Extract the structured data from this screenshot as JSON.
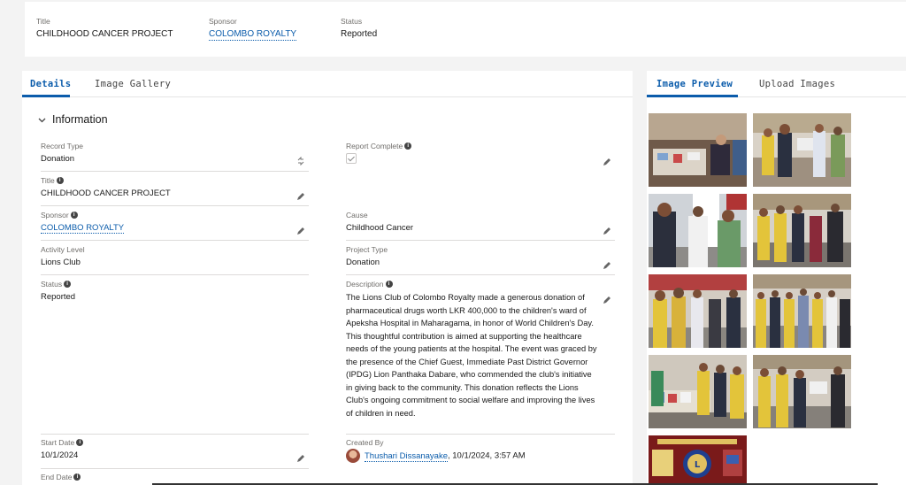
{
  "header": {
    "title_label": "Title",
    "title_value": "CHILDHOOD CANCER PROJECT",
    "sponsor_label": "Sponsor",
    "sponsor_value": "COLOMBO ROYALTY",
    "status_label": "Status",
    "status_value": "Reported"
  },
  "left_tabs": [
    {
      "label": "Details"
    },
    {
      "label": "Image Gallery"
    }
  ],
  "right_tabs": [
    {
      "label": "Image Preview"
    },
    {
      "label": "Upload Images"
    }
  ],
  "section_title": "Information",
  "fields": {
    "record_type": {
      "label": "Record Type",
      "value": "Donation"
    },
    "report_complete": {
      "label": "Report Complete",
      "checked": true
    },
    "title": {
      "label": "Title",
      "value": "CHILDHOOD CANCER PROJECT"
    },
    "sponsor": {
      "label": "Sponsor",
      "value": "COLOMBO ROYALTY"
    },
    "cause": {
      "label": "Cause",
      "value": "Childhood Cancer"
    },
    "activity_level": {
      "label": "Activity Level",
      "value": "Lions Club"
    },
    "project_type": {
      "label": "Project Type",
      "value": "Donation"
    },
    "status": {
      "label": "Status",
      "value": "Reported"
    },
    "description": {
      "label": "Description",
      "value": "The Lions Club of Colombo Royalty made a generous donation of pharmaceutical drugs worth LKR 400,000 to the children's ward of Apeksha Hospital in Maharagama, in honor of World Children's Day. This thoughtful contribution is aimed at supporting the healthcare needs of the young patients at the hospital. The event was graced by the presence of the Chief Guest, Immediate Past District Governor (IPDG) Lion Panthaka Dabare, who commended the club's initiative in giving back to the community. This donation reflects the Lions Club's ongoing commitment to social welfare and improving the lives of children in need."
    },
    "start_date": {
      "label": "Start Date",
      "value": "10/1/2024"
    },
    "created_by": {
      "label": "Created By",
      "user": "Thushari Dissanayake",
      "timestamp": ", 10/1/2024, 3:57 AM"
    },
    "end_date": {
      "label": "End Date"
    }
  },
  "icons": {
    "info": "i",
    "chevron": "chevron-down-icon",
    "edit": "pencil-icon",
    "swap": "change-record-type-icon"
  },
  "colors": {
    "accent": "#0b5cab",
    "label": "#706e6b",
    "background": "#f3f3f3"
  }
}
